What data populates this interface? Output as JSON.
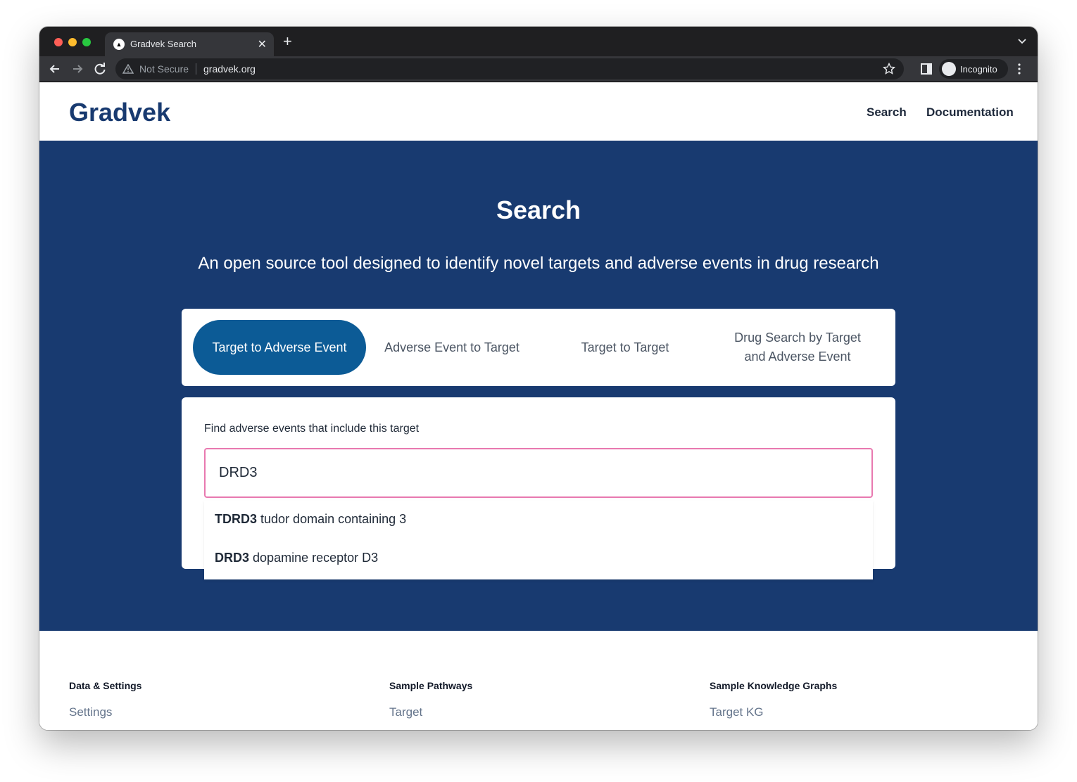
{
  "browser": {
    "tab_title": "Gradvek Search",
    "new_tab_symbol": "+",
    "security_label": "Not Secure",
    "url": "gradvek.org",
    "profile_label": "Incognito"
  },
  "header": {
    "logo": "Gradvek",
    "nav": [
      "Search",
      "Documentation"
    ]
  },
  "hero": {
    "title": "Search",
    "subtitle": "An open source tool designed to identify novel targets and adverse events in drug research"
  },
  "mode_tabs": [
    {
      "label": "Target to Adverse Event",
      "active": true
    },
    {
      "label": "Adverse Event to Target",
      "active": false
    },
    {
      "label": "Target to Target",
      "active": false
    },
    {
      "label": "Drug Search by Target and Adverse Event",
      "active": false
    }
  ],
  "search": {
    "label": "Find adverse events that include this target",
    "value": "DRD3",
    "suggestions": [
      {
        "symbol": "TDRD3",
        "name": "tudor domain containing 3"
      },
      {
        "symbol": "DRD3",
        "name": "dopamine receptor D3"
      }
    ]
  },
  "footer": {
    "columns": [
      {
        "heading": "Data & Settings",
        "link": "Settings"
      },
      {
        "heading": "Sample Pathways",
        "link": "Target"
      },
      {
        "heading": "Sample Knowledge Graphs",
        "link": "Target KG"
      }
    ]
  },
  "colors": {
    "brand_navy": "#183a70",
    "active_tab": "#0c5b96",
    "input_focus_border": "#e879b0"
  }
}
